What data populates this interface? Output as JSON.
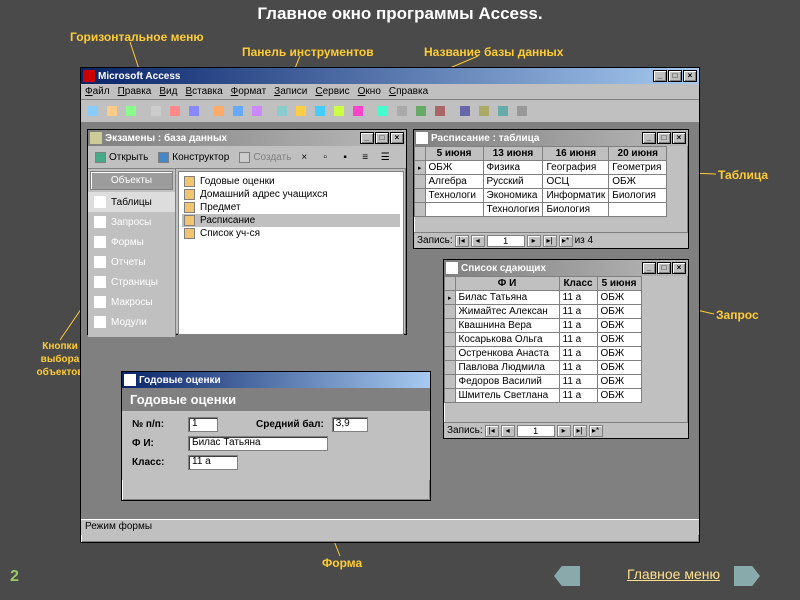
{
  "slide": {
    "title": "Главное окно программы Access.",
    "number": "2",
    "main_menu_link": "Главное меню"
  },
  "callouts": {
    "horiz_menu": "Горизонтальное меню",
    "toolbar": "Панель инструментов",
    "db_name": "Название базы данных",
    "obj_buttons": "Кнопки выбора объектов",
    "form": "Форма",
    "table": "Таблица",
    "query": "Запрос"
  },
  "app": {
    "title": "Microsoft Access",
    "menu": [
      "Файл",
      "Правка",
      "Вид",
      "Вставка",
      "Формат",
      "Записи",
      "Сервис",
      "Окно",
      "Справка"
    ],
    "status": "Режим формы"
  },
  "db_window": {
    "title": "Экзамены : база данных",
    "toolbar": {
      "open": "Открыть",
      "design": "Конструктор",
      "create": "Создать"
    },
    "objects_header": "Объекты",
    "objects": [
      "Таблицы",
      "Запросы",
      "Формы",
      "Отчеты",
      "Страницы",
      "Макросы",
      "Модули"
    ],
    "selected_object_index": 0,
    "items": [
      "Годовые оценки",
      "Домашний адрес учащихся",
      "Предмет",
      "Расписание",
      "Список уч-ся"
    ],
    "selected_item_index": 3
  },
  "table_window": {
    "title": "Расписание : таблица",
    "headers": [
      "5 июня",
      "13 июня",
      "16 июня",
      "20 июня"
    ],
    "rows": [
      [
        "ОБЖ",
        "Физика",
        "География",
        "Геометрия"
      ],
      [
        "Алгебра",
        "Русский",
        "ОСЦ",
        "ОБЖ"
      ],
      [
        "Технологи",
        "Экономика",
        "Информатик",
        "Биология"
      ],
      [
        "",
        "Технология",
        "Биология",
        ""
      ]
    ],
    "nav": {
      "label": "Запись:",
      "value": "1",
      "total": "из 4"
    }
  },
  "query_window": {
    "title": "Список сдающих",
    "headers": [
      "Ф И",
      "Класс",
      "5 июня"
    ],
    "rows": [
      [
        "Билас Татьяна",
        "11 а",
        "ОБЖ"
      ],
      [
        "Жимайтес Алексан",
        "11 а",
        "ОБЖ"
      ],
      [
        "Квашнина Вера",
        "11 а",
        "ОБЖ"
      ],
      [
        "Косарькова Ольга",
        "11 а",
        "ОБЖ"
      ],
      [
        "Остренкова Анаста",
        "11 а",
        "ОБЖ"
      ],
      [
        "Павлова Людмила",
        "11 а",
        "ОБЖ"
      ],
      [
        "Федоров Василий",
        "11 а",
        "ОБЖ"
      ],
      [
        "Шмитель Светлана",
        "11 а",
        "ОБЖ"
      ]
    ],
    "nav": {
      "label": "Запись:",
      "value": "1"
    }
  },
  "form_window": {
    "title": "Годовые оценки",
    "header": "Годовые оценки",
    "fields": {
      "num_label": "№ п/п:",
      "num_value": "1",
      "avg_label": "Средний бал:",
      "avg_value": "3,9",
      "name_label": "Ф И:",
      "name_value": "Билас Татьяна",
      "class_label": "Класс:",
      "class_value": "11 а"
    }
  }
}
